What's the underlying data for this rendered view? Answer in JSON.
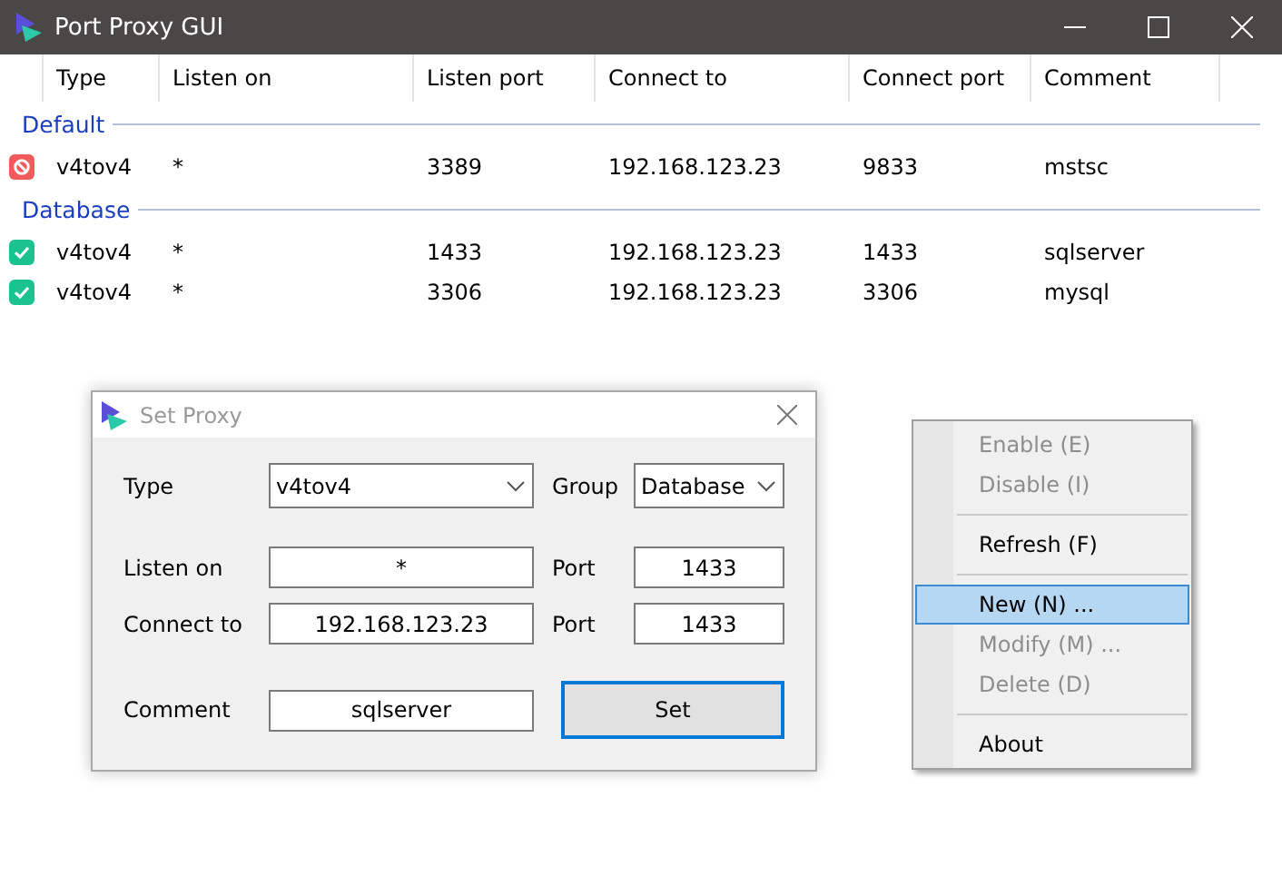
{
  "window": {
    "title": "Port Proxy GUI"
  },
  "table": {
    "columns": [
      "Type",
      "Listen on",
      "Listen port",
      "Connect to",
      "Connect port",
      "Comment"
    ],
    "groups": [
      {
        "name": "Default",
        "rows": [
          {
            "enabled": false,
            "cells": [
              "v4tov4",
              "*",
              "3389",
              "192.168.123.23",
              "9833",
              "mstsc"
            ]
          }
        ]
      },
      {
        "name": "Database",
        "rows": [
          {
            "enabled": true,
            "cells": [
              "v4tov4",
              "*",
              "1433",
              "192.168.123.23",
              "1433",
              "sqlserver"
            ]
          },
          {
            "enabled": true,
            "cells": [
              "v4tov4",
              "*",
              "3306",
              "192.168.123.23",
              "3306",
              "mysql"
            ]
          }
        ]
      }
    ]
  },
  "dialog": {
    "title": "Set Proxy",
    "type": {
      "label": "Type",
      "value": "v4tov4"
    },
    "group": {
      "label": "Group",
      "value": "Database"
    },
    "listen_on": {
      "label": "Listen on",
      "value": "*"
    },
    "listen_port": {
      "label": "Port",
      "value": "1433"
    },
    "connect_to": {
      "label": "Connect to",
      "value": "192.168.123.23"
    },
    "connect_port": {
      "label": "Port",
      "value": "1433"
    },
    "comment": {
      "label": "Comment",
      "value": "sqlserver"
    },
    "button": "Set"
  },
  "context_menu": [
    {
      "kind": "item",
      "label": "Enable (E)",
      "disabled": true,
      "selected": false
    },
    {
      "kind": "item",
      "label": "Disable (I)",
      "disabled": true,
      "selected": false
    },
    {
      "kind": "separator"
    },
    {
      "kind": "item",
      "label": "Refresh (F)",
      "disabled": false,
      "selected": false
    },
    {
      "kind": "separator"
    },
    {
      "kind": "item",
      "label": "New (N) ...",
      "disabled": false,
      "selected": true
    },
    {
      "kind": "item",
      "label": "Modify (M) ...",
      "disabled": true,
      "selected": false
    },
    {
      "kind": "item",
      "label": "Delete (D)",
      "disabled": true,
      "selected": false
    },
    {
      "kind": "separator"
    },
    {
      "kind": "item",
      "label": "About",
      "disabled": false,
      "selected": false
    }
  ]
}
